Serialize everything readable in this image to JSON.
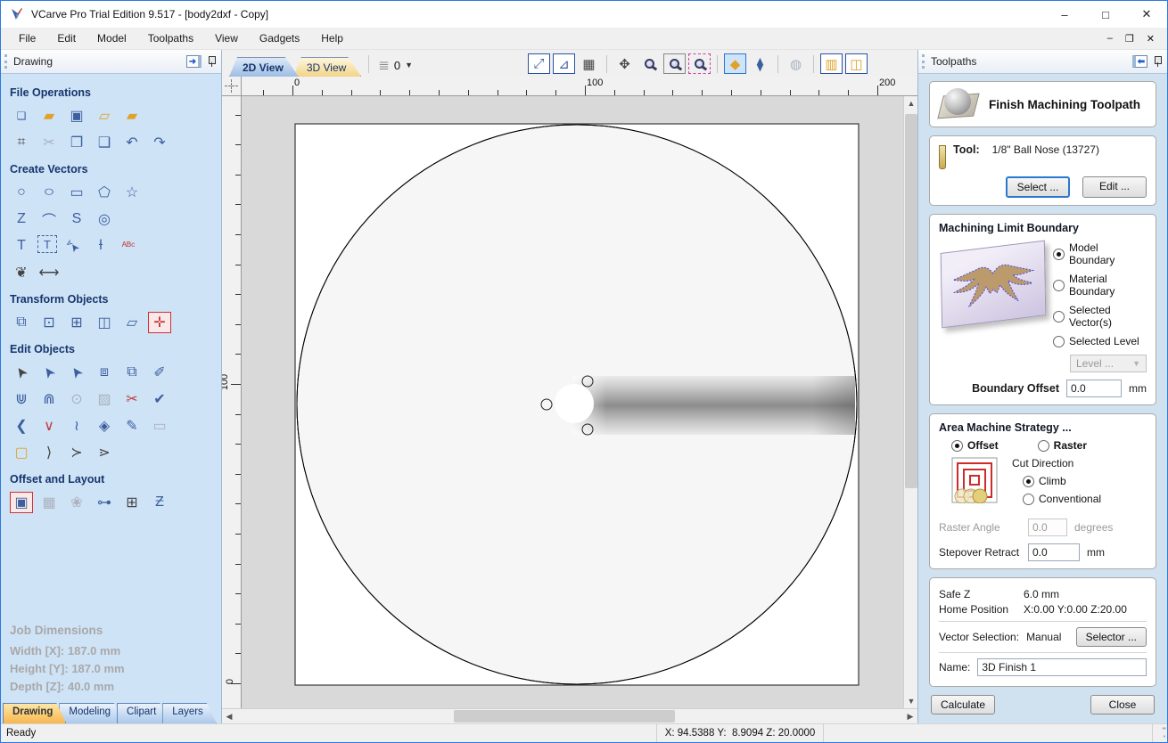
{
  "window": {
    "title": "VCarve Pro Trial Edition 9.517 - [body2dxf - Copy]",
    "controls": {
      "minimize": "–",
      "maximize": "□",
      "close": "✕"
    }
  },
  "menu": {
    "items": [
      "File",
      "Edit",
      "Model",
      "Toolpaths",
      "View",
      "Gadgets",
      "Help"
    ],
    "mdi_controls": {
      "minimize": "–",
      "restore": "❐",
      "close": "✕"
    }
  },
  "left_panel": {
    "header": "Drawing",
    "sections": {
      "file_operations": {
        "title": "File Operations",
        "row1": [
          {
            "name": "new-file-icon",
            "glyph": "❏",
            "cls": "small"
          },
          {
            "name": "open-file-icon",
            "glyph": "▰",
            "cls": "gold"
          },
          {
            "name": "save-file-icon",
            "glyph": "▣"
          },
          {
            "name": "import-vectors-icon",
            "glyph": "▱",
            "cls": "gold"
          },
          {
            "name": "import-bitmap-icon",
            "glyph": "▰",
            "cls": "gold"
          }
        ],
        "row2": [
          {
            "name": "job-setup-icon",
            "glyph": "⌗",
            "cls": "dark"
          },
          {
            "name": "cut-icon",
            "glyph": "✂",
            "cls": "gray"
          },
          {
            "name": "copy-icon",
            "glyph": "❐"
          },
          {
            "name": "paste-icon",
            "glyph": "❑"
          },
          {
            "name": "undo-icon",
            "glyph": "↶"
          },
          {
            "name": "redo-icon",
            "glyph": "↷"
          }
        ]
      },
      "create_vectors": {
        "title": "Create Vectors",
        "row1": [
          {
            "name": "draw-circle-icon",
            "glyph": "○"
          },
          {
            "name": "draw-ellipse-icon",
            "glyph": "○",
            "cls": "stretch"
          },
          {
            "name": "draw-rectangle-icon",
            "glyph": "▭"
          },
          {
            "name": "draw-polygon-icon",
            "glyph": "⬠"
          },
          {
            "name": "draw-star-icon",
            "glyph": "☆"
          }
        ],
        "row2": [
          {
            "name": "draw-polyline-icon",
            "glyph": "Z"
          },
          {
            "name": "draw-arc-icon",
            "glyph": "⌒"
          },
          {
            "name": "draw-curve-icon",
            "glyph": "S"
          },
          {
            "name": "draw-vector-texture-icon",
            "glyph": "◎"
          }
        ],
        "row3": [
          {
            "name": "draw-text-icon",
            "glyph": "T"
          },
          {
            "name": "draw-text-box-icon",
            "glyph": "T",
            "cls": "dashedbox"
          },
          {
            "name": "edit-text-icon",
            "glyph": "➤ᴬ",
            "cls": "rot-nw small"
          },
          {
            "name": "letter-spacing-icon",
            "glyph": "Ɨ"
          },
          {
            "name": "text-on-curve-icon",
            "glyph": "ᴬᴮᶜ",
            "cls": "small red"
          }
        ],
        "row4": [
          {
            "name": "clipart-bird-icon",
            "glyph": "❦",
            "cls": "dark"
          },
          {
            "name": "dimensions-icon",
            "glyph": "⟷",
            "cls": "dark"
          }
        ]
      },
      "transform_objects": {
        "title": "Transform Objects",
        "row1": [
          {
            "name": "move-selection-icon",
            "glyph": "⧉"
          },
          {
            "name": "set-size-icon",
            "glyph": "⊡"
          },
          {
            "name": "align-centre-icon",
            "glyph": "⊞"
          },
          {
            "name": "mirror-icon",
            "glyph": "◫"
          },
          {
            "name": "distort-icon",
            "glyph": "▱"
          },
          {
            "name": "alignment-tools-icon",
            "glyph": "✛",
            "cls": "activebox red"
          }
        ]
      },
      "edit_objects": {
        "title": "Edit Objects",
        "row1": [
          {
            "name": "select-cursor-icon",
            "glyph": "➤",
            "cls": "rot-nw dark"
          },
          {
            "name": "node-edit-cursor-icon",
            "glyph": "➤",
            "cls": "rot-nw"
          },
          {
            "name": "transform-cursor-icon",
            "glyph": "➤",
            "cls": "rot-nw"
          },
          {
            "name": "group-icon",
            "glyph": "⧈"
          },
          {
            "name": "ungroup-icon",
            "glyph": "⧉"
          },
          {
            "name": "measure-icon",
            "glyph": "✐"
          }
        ],
        "row2": [
          {
            "name": "weld-vectors-icon",
            "glyph": "⋓"
          },
          {
            "name": "subtract-vectors-icon",
            "glyph": "⋒"
          },
          {
            "name": "intersect-vectors-icon",
            "glyph": "⊙",
            "cls": "gray"
          },
          {
            "name": "vector-validator-icon",
            "glyph": "▨",
            "cls": "gray"
          },
          {
            "name": "trim-vectors-icon",
            "glyph": "✂",
            "cls": "red"
          },
          {
            "name": "fillet-icon",
            "glyph": "✔"
          }
        ],
        "row3": [
          {
            "name": "close-vector-icon",
            "glyph": "❮"
          },
          {
            "name": "fit-vectors-icon",
            "glyph": "∨",
            "cls": "red"
          },
          {
            "name": "fit-curve-icon",
            "glyph": "≀"
          },
          {
            "name": "edit-nodes-icon",
            "glyph": "◈"
          },
          {
            "name": "edit-picture-icon",
            "glyph": "✎"
          },
          {
            "name": "crop-bitmap-icon",
            "glyph": "▭",
            "cls": "gray"
          }
        ],
        "row4": [
          {
            "name": "trace-bitmap-icon",
            "glyph": "▢",
            "cls": "gold"
          },
          {
            "name": "join-vectors-move-icon",
            "glyph": "⟩",
            "cls": "dark"
          },
          {
            "name": "join-vectors-line-icon",
            "glyph": "≻",
            "cls": "dark"
          },
          {
            "name": "join-vectors-curve-icon",
            "glyph": "⋗",
            "cls": "dark"
          }
        ]
      },
      "offset_layout": {
        "title": "Offset and Layout",
        "row1": [
          {
            "name": "offset-vectors-icon",
            "glyph": "▣",
            "cls": "activebox"
          },
          {
            "name": "array-copy-icon",
            "glyph": "▦",
            "cls": "gray"
          },
          {
            "name": "circular-copy-icon",
            "glyph": "❀",
            "cls": "gray"
          },
          {
            "name": "copy-along-vectors-icon",
            "glyph": "⊶"
          },
          {
            "name": "nesting-icon",
            "glyph": "⊞",
            "cls": "dark"
          },
          {
            "name": "true-shape-nesting-icon",
            "glyph": "Ƶ"
          }
        ]
      }
    },
    "job_dimensions": {
      "title": "Job Dimensions",
      "lines": [
        "Width  [X]: 187.0 mm",
        "Height [Y]: 187.0 mm",
        "Depth  [Z]: 40.0 mm"
      ]
    },
    "tabs": [
      "Drawing",
      "Modeling",
      "Clipart",
      "Layers"
    ],
    "active_tab": "Drawing"
  },
  "view_tabs": {
    "tab_2d": "2D View",
    "tab_3d": "3D View"
  },
  "layer_control": {
    "value": "0"
  },
  "toolbar": [
    {
      "name": "fit-to-window-icon",
      "glyph": "⤢",
      "cls": "framed"
    },
    {
      "name": "zoom-to-drawing-icon",
      "glyph": "⊿",
      "cls": "framed"
    },
    {
      "name": "toggle-grid-icon",
      "glyph": "▦",
      "cls": "dark"
    },
    {
      "kind": "sep"
    },
    {
      "name": "pan-icon",
      "glyph": "✥",
      "cls": "dark"
    },
    {
      "name": "zoom-interactive-icon",
      "kind": "mag"
    },
    {
      "name": "zoom-box-icon",
      "kind": "mag",
      "cls": "zoombox"
    },
    {
      "name": "zoom-selected-icon",
      "kind": "mag",
      "cls": "zoomsel"
    },
    {
      "kind": "sep"
    },
    {
      "name": "toggle-2d-toolpaths-icon",
      "glyph": "◆",
      "cls": "pressed gold"
    },
    {
      "name": "toolpath-drawing-icon",
      "glyph": "⧫",
      "cls": "small"
    },
    {
      "kind": "sep"
    },
    {
      "name": "preview-toolpaths-icon",
      "glyph": "◍",
      "cls": "gray"
    },
    {
      "kind": "sep"
    },
    {
      "name": "layout-toolpath-tab-icon",
      "glyph": "▥",
      "cls": "framed gold"
    },
    {
      "name": "layout-side-by-side-icon",
      "glyph": "◫",
      "cls": "framed gold"
    }
  ],
  "rulers": {
    "h_labels": [
      {
        "text": "0",
        "mm": 0
      },
      {
        "text": "100",
        "mm": 100
      },
      {
        "text": "200",
        "mm": 200
      }
    ],
    "v_labels": [
      {
        "text": "100",
        "mm": 100
      },
      {
        "text": "0",
        "mm": 0
      }
    ]
  },
  "right_panel": {
    "header": "Toolpaths",
    "toolpath_title": "Finish Machining Toolpath",
    "tool": {
      "label": "Tool:",
      "name": "1/8\" Ball Nose (13727)",
      "select_btn": "Select ...",
      "edit_btn": "Edit ..."
    },
    "boundary": {
      "title": "Machining Limit Boundary",
      "options": [
        "Model Boundary",
        "Material Boundary",
        "Selected Vector(s)",
        "Selected Level"
      ],
      "selected": "Model Boundary",
      "level_dropdown": "Level ...",
      "offset_label": "Boundary Offset",
      "offset_value": "0.0",
      "offset_unit": "mm"
    },
    "strategy": {
      "title": "Area Machine Strategy ...",
      "offset_label": "Offset",
      "raster_label": "Raster",
      "selected_mode": "Offset",
      "cut_direction_label": "Cut Direction",
      "climb_label": "Climb",
      "conventional_label": "Conventional",
      "selected_cut_direction": "Climb",
      "raster_angle_label": "Raster Angle",
      "raster_angle_value": "0.0",
      "raster_angle_unit": "degrees",
      "stepover_label": "Stepover Retract",
      "stepover_value": "0.0",
      "stepover_unit": "mm"
    },
    "summary": {
      "safe_z_label": "Safe Z",
      "safe_z_value": "6.0 mm",
      "home_label": "Home Position",
      "home_value": "X:0.00 Y:0.00 Z:20.00",
      "vector_selection_label": "Vector Selection:",
      "vector_selection_value": "Manual",
      "selector_btn": "Selector ...",
      "name_label": "Name:",
      "name_value": "3D Finish 1"
    },
    "calculate_btn": "Calculate",
    "close_btn": "Close"
  },
  "status": {
    "ready": "Ready",
    "coords": "X: 94.5388 Y:  8.9094 Z: 20.0000"
  }
}
